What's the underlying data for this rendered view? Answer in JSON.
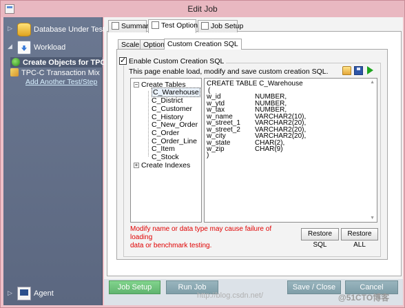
{
  "window": {
    "title": "Edit Job"
  },
  "nav": {
    "database_under_test": "Database Under Test",
    "workload": "Workload",
    "create_objects": "Create Objects for TPC-C",
    "tpcc_transaction_mix": "TPC-C Transaction Mix",
    "add_another_test": "Add Another Test/Step",
    "agent": "Agent"
  },
  "tabs": {
    "summary": "Summary",
    "test_options": "Test Options",
    "job_setup": "Job Setup"
  },
  "subtabs": {
    "scale": "Scale",
    "options": "Options",
    "custom_sql": "Custom Creation SQL"
  },
  "custom_sql": {
    "enable_label": "Enable Custom Creation SQL",
    "enabled": true,
    "description": "This page enable load, modify and save custom creation SQL.",
    "warning_line1": "Modify name or data type may cause failure of loading",
    "warning_line2": "data or benchmark testing.",
    "restore_sql": "Restore SQL",
    "restore_all": "Restore ALL"
  },
  "tree": {
    "create_tables": "Create Tables",
    "tables": [
      "C_Warehouse",
      "C_District",
      "C_Customer",
      "C_History",
      "C_New_Order",
      "C_Order",
      "C_Order_Line",
      "C_Item",
      "C_Stock"
    ],
    "selected_table": "C_Warehouse",
    "create_indexes": "Create Indexes"
  },
  "sql": {
    "header": "CREATE TABLE C_Warehouse",
    "open_paren": "(",
    "close_paren": ")",
    "columns": [
      {
        "name": "w_id",
        "type": "NUMBER,"
      },
      {
        "name": "w_ytd",
        "type": "NUMBER,"
      },
      {
        "name": "w_tax",
        "type": "NUMBER,"
      },
      {
        "name": "w_name",
        "type": "VARCHAR2(10),"
      },
      {
        "name": "w_street_1",
        "type": "VARCHAR2(20),"
      },
      {
        "name": "w_street_2",
        "type": "VARCHAR2(20),"
      },
      {
        "name": "w_city",
        "type": "VARCHAR2(20),"
      },
      {
        "name": "w_state",
        "type": "CHAR(2),"
      },
      {
        "name": "w_zip",
        "type": "CHAR(9)"
      }
    ]
  },
  "footer": {
    "job_setup": "Job Setup",
    "run_job": "Run Job",
    "save_close": "Save / Close",
    "cancel": "Cancel"
  },
  "watermark": {
    "url": "http://blog.csdn.net/",
    "brand": "@51CTO博客"
  }
}
